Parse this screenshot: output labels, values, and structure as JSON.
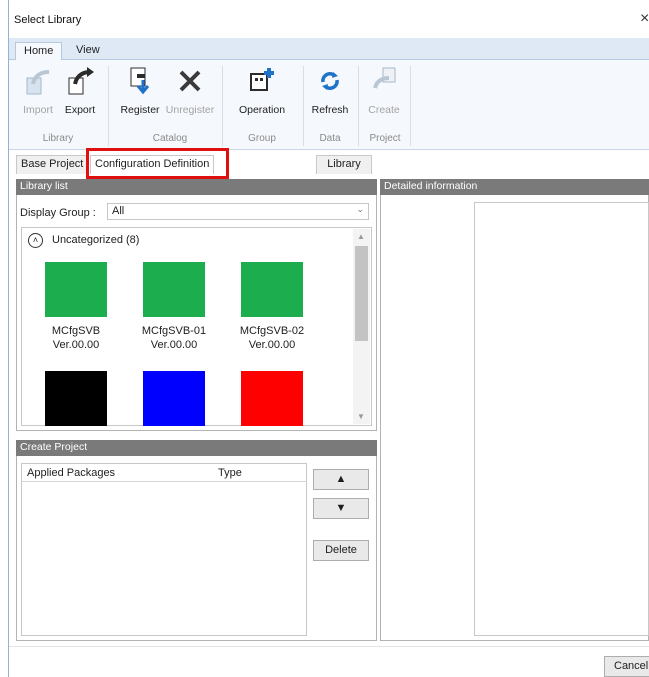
{
  "window": {
    "title": "Select Library",
    "close": "×"
  },
  "ribbon": {
    "tabs": [
      {
        "label": "Home"
      },
      {
        "label": "View"
      }
    ],
    "buttons": {
      "import": "Import",
      "export": "Export",
      "register": "Register",
      "unregister": "Unregister",
      "operation": "Operation",
      "refresh": "Refresh",
      "create": "Create"
    },
    "groups": {
      "library": "Library",
      "catalog": "Catalog",
      "group": "Group",
      "data": "Data",
      "project": "Project"
    }
  },
  "tabs": {
    "base_project": "Base Project",
    "config_def": "Configuration Definition",
    "library": "Library"
  },
  "library_list": {
    "header": "Library list",
    "display_group_label": "Display Group :",
    "display_group_value": "All",
    "category": "Uncategorized (8)",
    "items": [
      {
        "name": "MCfgSVB",
        "version": "Ver.00.00",
        "color": "#1cad4f"
      },
      {
        "name": "MCfgSVB-01",
        "version": "Ver.00.00",
        "color": "#1cad4f"
      },
      {
        "name": "MCfgSVB-02",
        "version": "Ver.00.00",
        "color": "#1cad4f"
      },
      {
        "color": "#000000"
      },
      {
        "color": "#0000ff"
      },
      {
        "color": "#ff0000"
      }
    ]
  },
  "create_project": {
    "header": "Create Project",
    "columns": [
      "Applied Packages",
      "Type"
    ],
    "up": "▲",
    "down": "▼",
    "delete": "Delete"
  },
  "detail": {
    "header": "Detailed information"
  },
  "footer": {
    "cancel": "Cancel"
  },
  "colors": {
    "highlight": "#e01010",
    "panel_header": "#7a7a7a"
  }
}
